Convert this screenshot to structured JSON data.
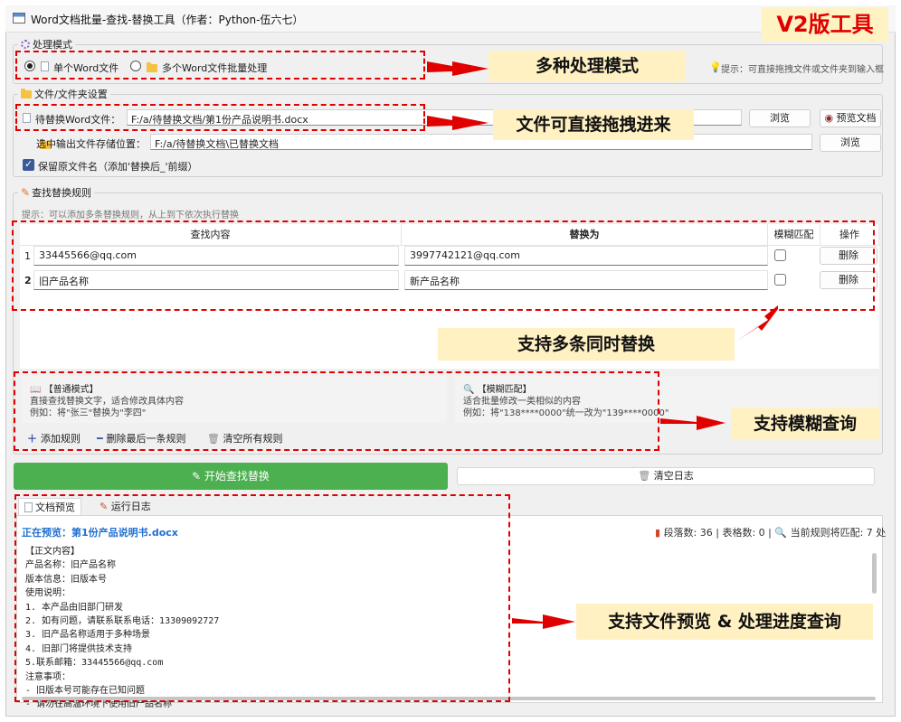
{
  "window": {
    "title": "Word文档批量-查找-替换工具（作者：Python-伍六七）"
  },
  "badge": "V2版工具",
  "mode_group": {
    "legend": "处理模式",
    "single": "单个Word文件",
    "multi": "多个Word文件批量处理",
    "hint": "提示：可直接拖拽文件或文件夹到输入框"
  },
  "file_group": {
    "legend": "文件/文件夹设置",
    "source_label": "待替换Word文件：",
    "source_value": "F:/a/待替换文档/第1份产品说明书.docx",
    "browse": "浏览",
    "preview": "预览文档",
    "output_label": "选中输出文件存储位置：",
    "output_value": "F:/a/待替换文档\\已替换文档",
    "browse2": "浏览",
    "keep_name": "保留原文件名（添加'替换后_'前缀）"
  },
  "rules_group": {
    "legend": "查找替换规则",
    "hint": "提示：可以添加多条替换规则，从上到下依次执行替换",
    "headers": {
      "find": "查找内容",
      "replace": "替换为",
      "fuzzy": "模糊匹配",
      "action": "操作"
    },
    "rows": [
      {
        "num": "1",
        "find": "33445566@qq.com",
        "replace": "3997742121@qq.com",
        "fuzzy": false,
        "action": "删除"
      },
      {
        "num": "2",
        "find": "旧产品名称",
        "replace": "新产品名称",
        "fuzzy": false,
        "action": "删除"
      }
    ],
    "normal_mode": {
      "title": "【普通模式】",
      "line1": "直接查找替换文字，适合修改具体内容",
      "line2": "例如：将\"张三\"替换为\"李四\""
    },
    "fuzzy_mode": {
      "title": "【模糊匹配】",
      "line1": "适合批量修改一类相似的内容",
      "line2": "例如：将\"138****0000\"统一改为\"139****0000\""
    },
    "add_rule": "添加规则",
    "remove_last": "删除最后一条规则",
    "clear_all": "清空所有规则"
  },
  "actions": {
    "start": "开始查找替换",
    "clear_log": "清空日志"
  },
  "tabs": {
    "preview": "文档预览",
    "log": "运行日志"
  },
  "preview": {
    "title": "正在预览：第1份产品说明书.docx",
    "stats": "段落数: 36 | 表格数: 0 |",
    "match": "当前规则将匹配: 7 处",
    "content": "【正文内容】\n产品名称：旧产品名称\n版本信息：旧版本号\n使用说明：\n1. 本产品由旧部门研发\n2. 如有问题，请联系联系电话：13309092727\n3. 旧产品名称适用于多种场景\n4. 旧部门将提供技术支持\n5.联系邮箱：33445566@qq.com\n注意事项：\n- 旧版本号可能存在已知问题\n- 请勿在高温环境下使用旧产品名称"
  },
  "callouts": {
    "modes": "多种处理模式",
    "drag": "文件可直接拖拽进来",
    "multi": "支持多条同时替换",
    "fuzzy": "支持模糊查询",
    "preview": "支持文件预览 & 处理进度查询"
  },
  "colors": {
    "accent_red": "#e00000",
    "start_green": "#4caf50",
    "callout_bg": "#fff1c2",
    "preview_blue": "#1f6fd1"
  }
}
